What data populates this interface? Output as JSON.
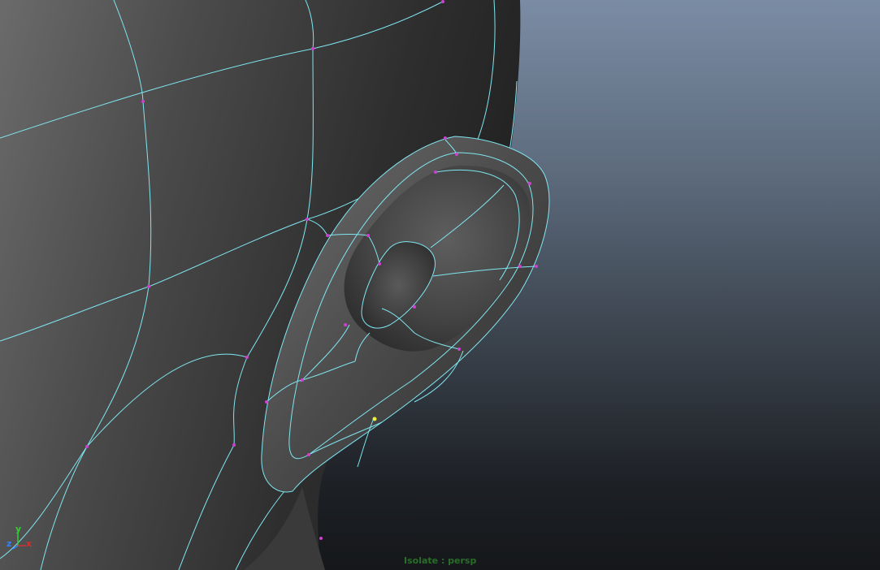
{
  "viewport": {
    "camera_label": "Isolate : persp"
  },
  "axis_gizmo": {
    "x_label": "x",
    "y_label": "y",
    "z_label": "z",
    "x_color": "#d03030",
    "y_color": "#30d030",
    "z_color": "#3080ff"
  },
  "colors": {
    "wireframe": "#7fe6f0",
    "vertex": "#d040d0",
    "selected_vertex": "#e8f040",
    "mesh_shade_light": "#6a6a6a",
    "mesh_shade_dark": "#2e2e2e"
  },
  "icons": {
    "axis": "view-axis-icon"
  }
}
